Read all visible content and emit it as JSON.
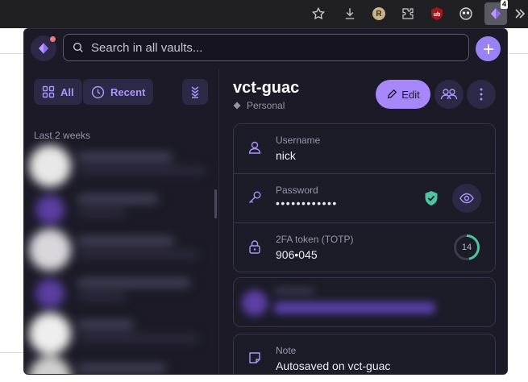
{
  "browser": {
    "extension_badge": "4",
    "profile_initial": "R"
  },
  "header": {
    "search_placeholder": "Search in all vaults..."
  },
  "sidebar": {
    "filters": [
      {
        "label": "All",
        "icon": "grid-icon"
      },
      {
        "label": "Recent",
        "icon": "clock-icon"
      }
    ],
    "section_label": "Last 2 weeks"
  },
  "item": {
    "title": "vct-guac",
    "vault": "Personal",
    "edit_label": "Edit",
    "fields": {
      "username_label": "Username",
      "username_value": "nick",
      "password_label": "Password",
      "password_value": "••••••••••••",
      "totp_label": "2FA token (TOTP)",
      "totp_value": "906•045",
      "totp_seconds": "14"
    },
    "note": {
      "label": "Note",
      "value": "Autosaved on vct-guac"
    }
  },
  "colors": {
    "accent": "#a688fa",
    "background": "#1b1a26",
    "shield": "#4fc3a1",
    "timer": "#4fc3a1"
  }
}
